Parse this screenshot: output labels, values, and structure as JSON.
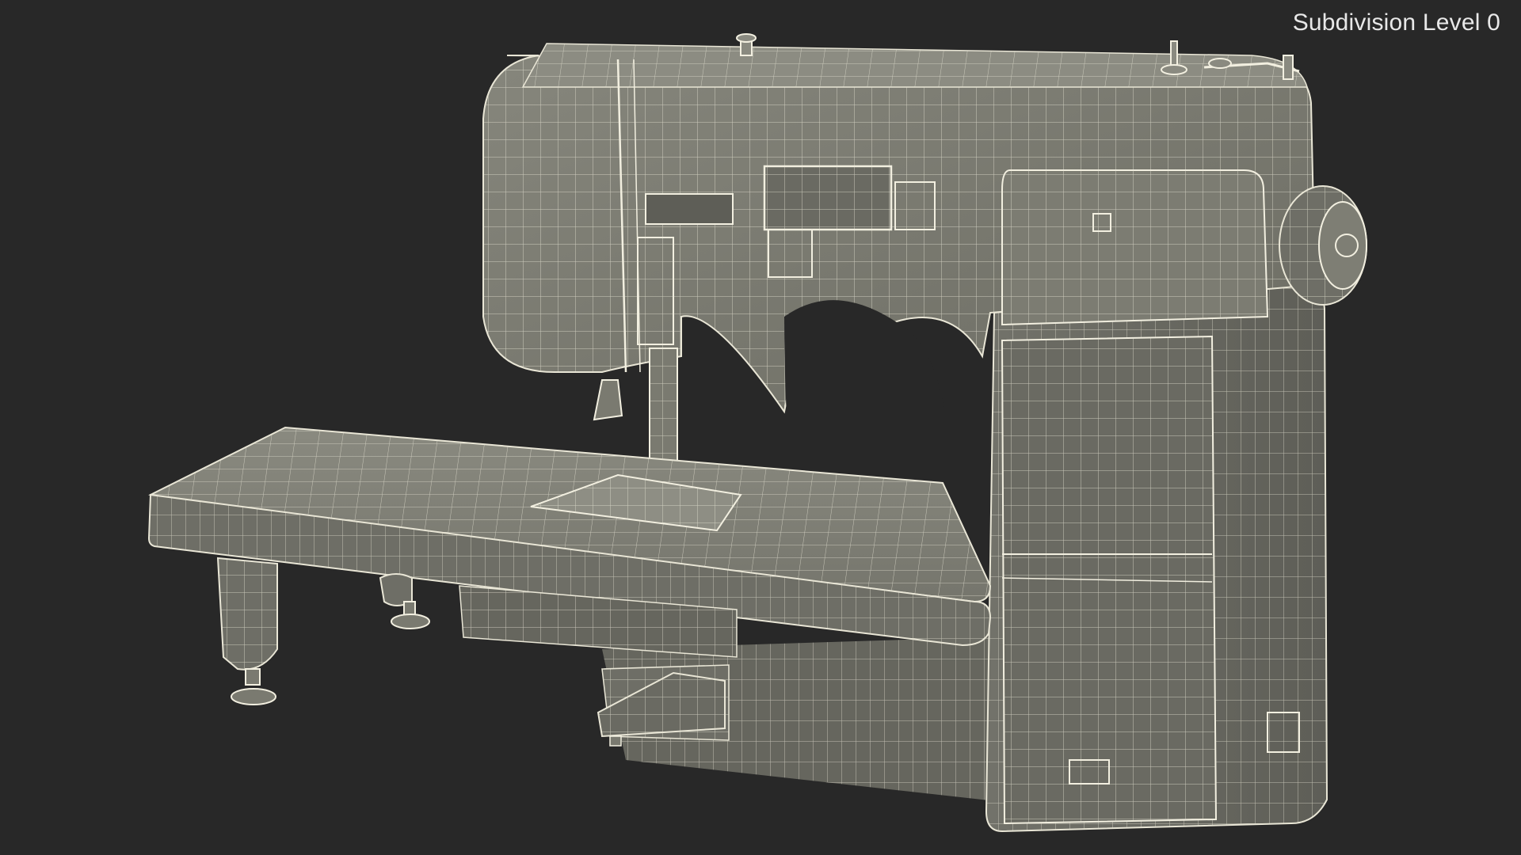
{
  "viewport": {
    "subdivision_label": "Subdivision Level 0",
    "background_color": "#282828",
    "model_fill_color": "#7a7a70",
    "wire_color": "#e9e6d6"
  },
  "model": {
    "subject": "sewing-machine-wireframe-icon"
  }
}
